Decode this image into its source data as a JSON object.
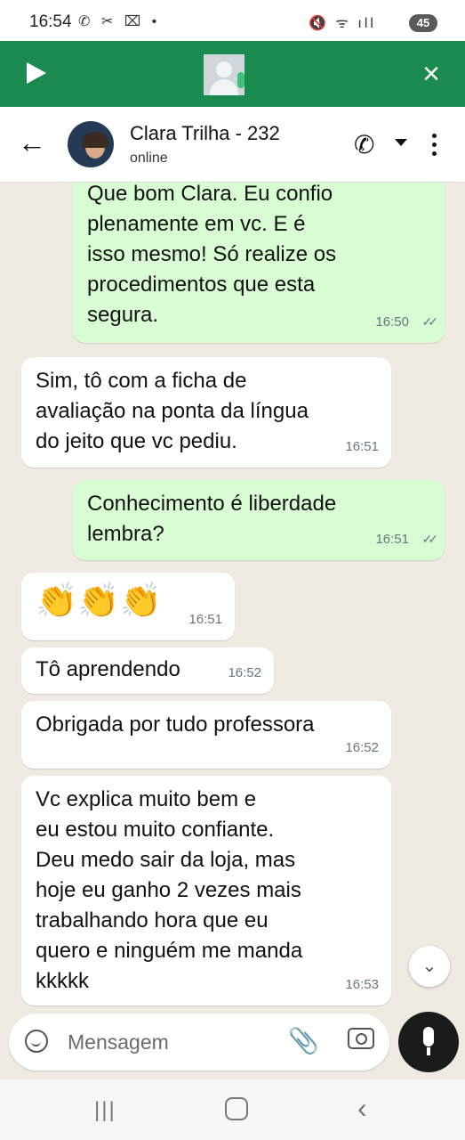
{
  "status_bar": {
    "time": "16:54",
    "left_icons": "✆ ✂ ⌧ •",
    "right_icons": "🔇 ᯤ ıll",
    "battery": "45"
  },
  "call_bar": {
    "accent": "#1a8a4f"
  },
  "header": {
    "back_icon": "←",
    "contact_name": "Clara Trilha - 232",
    "contact_status": "online",
    "call_icon": "✆"
  },
  "messages": [
    {
      "direction": "out",
      "text": "Que bom Clara. Eu confio\nplenamente em vc. E é\nisso mesmo! Só realize os\nprocedimentos que esta\nsegura.",
      "time": "16:50",
      "read": true
    },
    {
      "direction": "in",
      "text": "Sim, tô com a ficha de\navaliação na ponta da língua\ndo jeito que vc pediu.",
      "time": "16:51"
    },
    {
      "direction": "out",
      "text": "Conhecimento é liberdade\nlembra?",
      "time": "16:51",
      "read": true
    },
    {
      "direction": "in",
      "text": "👏👏👏",
      "time": "16:51"
    },
    {
      "direction": "in",
      "text": "Tô aprendendo",
      "time": "16:52"
    },
    {
      "direction": "in",
      "text": "Obrigada por tudo professora",
      "time": "16:52"
    },
    {
      "direction": "in",
      "text": "Vc explica muito bem e\neu estou muito confiante.\nDeu medo sair da loja, mas\nhoje eu ganho 2 vezes mais\ntrabalhando hora que eu\nquero e ninguém me manda\nkkkkk",
      "time": "16:53"
    }
  ],
  "ticks_glyph": "✓✓",
  "scroll_icon": "⌄",
  "input": {
    "placeholder": "Mensagem",
    "attach_icon": "📎"
  },
  "nav": {
    "recents": "|||",
    "back": "‹"
  },
  "colors": {
    "chat_background": "#efeae2",
    "outgoing_bubble": "#d9fdd3",
    "incoming_bubble": "#ffffff"
  }
}
